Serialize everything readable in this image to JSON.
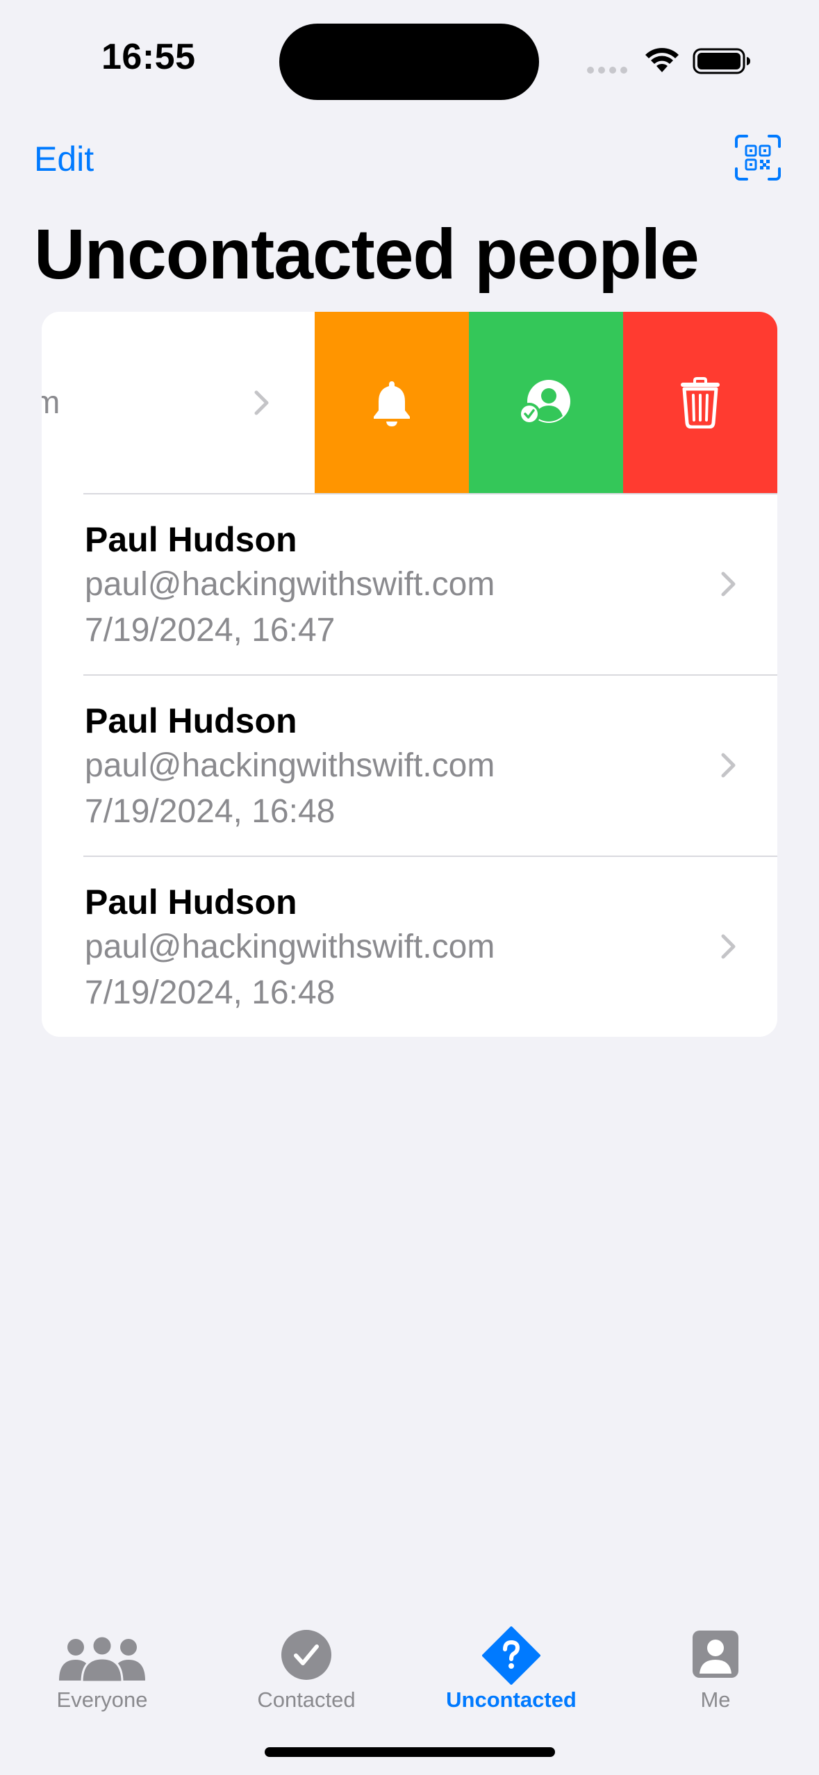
{
  "status_bar": {
    "time": "16:55"
  },
  "nav": {
    "edit_label": "Edit",
    "scan_icon": "qrcode-viewfinder-icon",
    "title": "Uncontacted people"
  },
  "colors": {
    "accent": "#007aff",
    "remind": "#ff9500",
    "contacted": "#34c759",
    "delete": "#ff3b30",
    "secondary_text": "#8a8a8e",
    "background": "#f2f2f7"
  },
  "list": {
    "swiped_row": {
      "visible_text": "m",
      "actions": [
        {
          "name": "remind",
          "icon": "bell-icon"
        },
        {
          "name": "mark-contacted",
          "icon": "person-checkmark-icon"
        },
        {
          "name": "delete",
          "icon": "trash-icon"
        }
      ]
    },
    "rows": [
      {
        "name": "Paul Hudson",
        "email": "paul@hackingwithswift.com",
        "date": "7/19/2024, 16:47"
      },
      {
        "name": "Paul Hudson",
        "email": "paul@hackingwithswift.com",
        "date": "7/19/2024, 16:48"
      },
      {
        "name": "Paul Hudson",
        "email": "paul@hackingwithswift.com",
        "date": "7/19/2024, 16:48"
      }
    ]
  },
  "tab_bar": {
    "tabs": [
      {
        "label": "Everyone",
        "icon": "person-3-icon",
        "selected": false
      },
      {
        "label": "Contacted",
        "icon": "checkmark-circle-icon",
        "selected": false
      },
      {
        "label": "Uncontacted",
        "icon": "questionmark-diamond-icon",
        "selected": true
      },
      {
        "label": "Me",
        "icon": "person-crop-square-icon",
        "selected": false
      }
    ]
  }
}
